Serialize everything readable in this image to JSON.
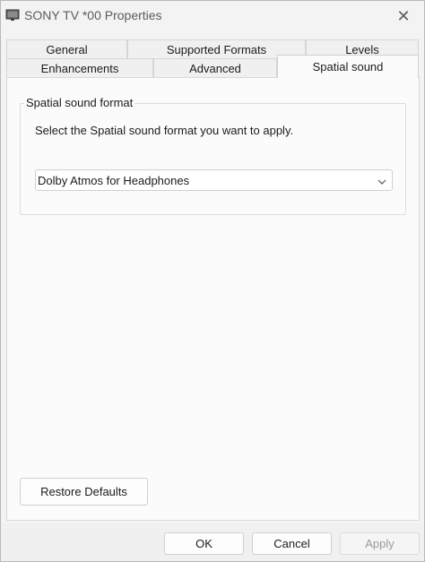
{
  "window": {
    "title": "SONY TV  *00 Properties",
    "icon": "speaker-device-icon",
    "close_glyph": "✕"
  },
  "tabs": {
    "row_top": [
      {
        "label": "General"
      },
      {
        "label": "Supported Formats"
      },
      {
        "label": "Levels"
      }
    ],
    "row_bottom": [
      {
        "label": "Enhancements"
      },
      {
        "label": "Advanced"
      },
      {
        "label": "Spatial sound",
        "active": true
      }
    ]
  },
  "spatial_sound": {
    "group_label": "Spatial sound format",
    "description": "Select the Spatial sound format you want to apply.",
    "format_select": {
      "selected": "Dolby Atmos for Headphones",
      "icon": "chevron-down-icon"
    },
    "restore_label": "Restore Defaults"
  },
  "footer": {
    "ok_label": "OK",
    "cancel_label": "Cancel",
    "apply_label": "Apply",
    "apply_enabled": false
  }
}
